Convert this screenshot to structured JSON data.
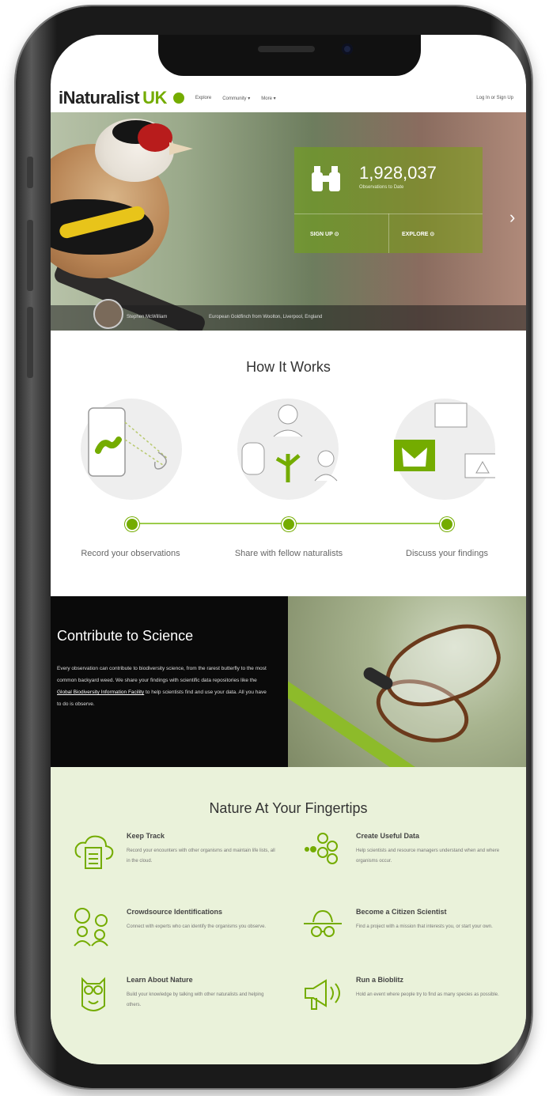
{
  "header": {
    "logo_main": "iNaturalist",
    "logo_uk": "UK",
    "nav": [
      "Explore",
      "Community ▾",
      "More ▾"
    ],
    "login": "Log In or Sign Up"
  },
  "hero": {
    "count": "1,928,037",
    "count_label": "Observations to Date",
    "sign_up": "SIGN UP ⊙",
    "explore": "EXPLORE ⊙",
    "next_arrow": "›",
    "caption_user": "Stephen McWilliam",
    "caption_text": "European Goldfinch from Woolton, Liverpool, England"
  },
  "how": {
    "title": "How It Works",
    "steps": [
      "Record your observations",
      "Share with fellow naturalists",
      "Discuss your findings"
    ]
  },
  "contribute": {
    "title": "Contribute to Science",
    "body_pre": "Every observation can contribute to biodiversity science, from the rarest butterfly to the most common backyard weed. We share your findings with scientific data repositories like the ",
    "link": "Global Biodiversity Information Facility",
    "body_post": " to help scientists find and use your data. All you have to do is observe."
  },
  "nature": {
    "title": "Nature At Your Fingertips",
    "features": [
      {
        "heading": "Keep Track",
        "desc": "Record your encounters with other organisms and maintain life lists, all in the cloud.",
        "icon": "cloud-list-icon"
      },
      {
        "heading": "Create Useful Data",
        "desc": "Help scientists and resource managers understand when and where organisms occur.",
        "icon": "data-cluster-icon"
      },
      {
        "heading": "Crowdsource Identifications",
        "desc": "Connect with experts who can identify the organisms you observe.",
        "icon": "people-chat-icon"
      },
      {
        "heading": "Become a Citizen Scientist",
        "desc": "Find a project with a mission that interests you, or start your own.",
        "icon": "scientist-icon"
      },
      {
        "heading": "Learn About Nature",
        "desc": "Build your knowledge by talking with other naturalists and helping others.",
        "icon": "owl-icon"
      },
      {
        "heading": "Run a Bioblitz",
        "desc": "Hold an event where people try to find as many species as possible.",
        "icon": "megaphone-icon"
      }
    ]
  },
  "colors": {
    "accent": "#74ac00",
    "nature_bg": "#eaf2da",
    "contrib_bg": "#0a0a0a"
  }
}
